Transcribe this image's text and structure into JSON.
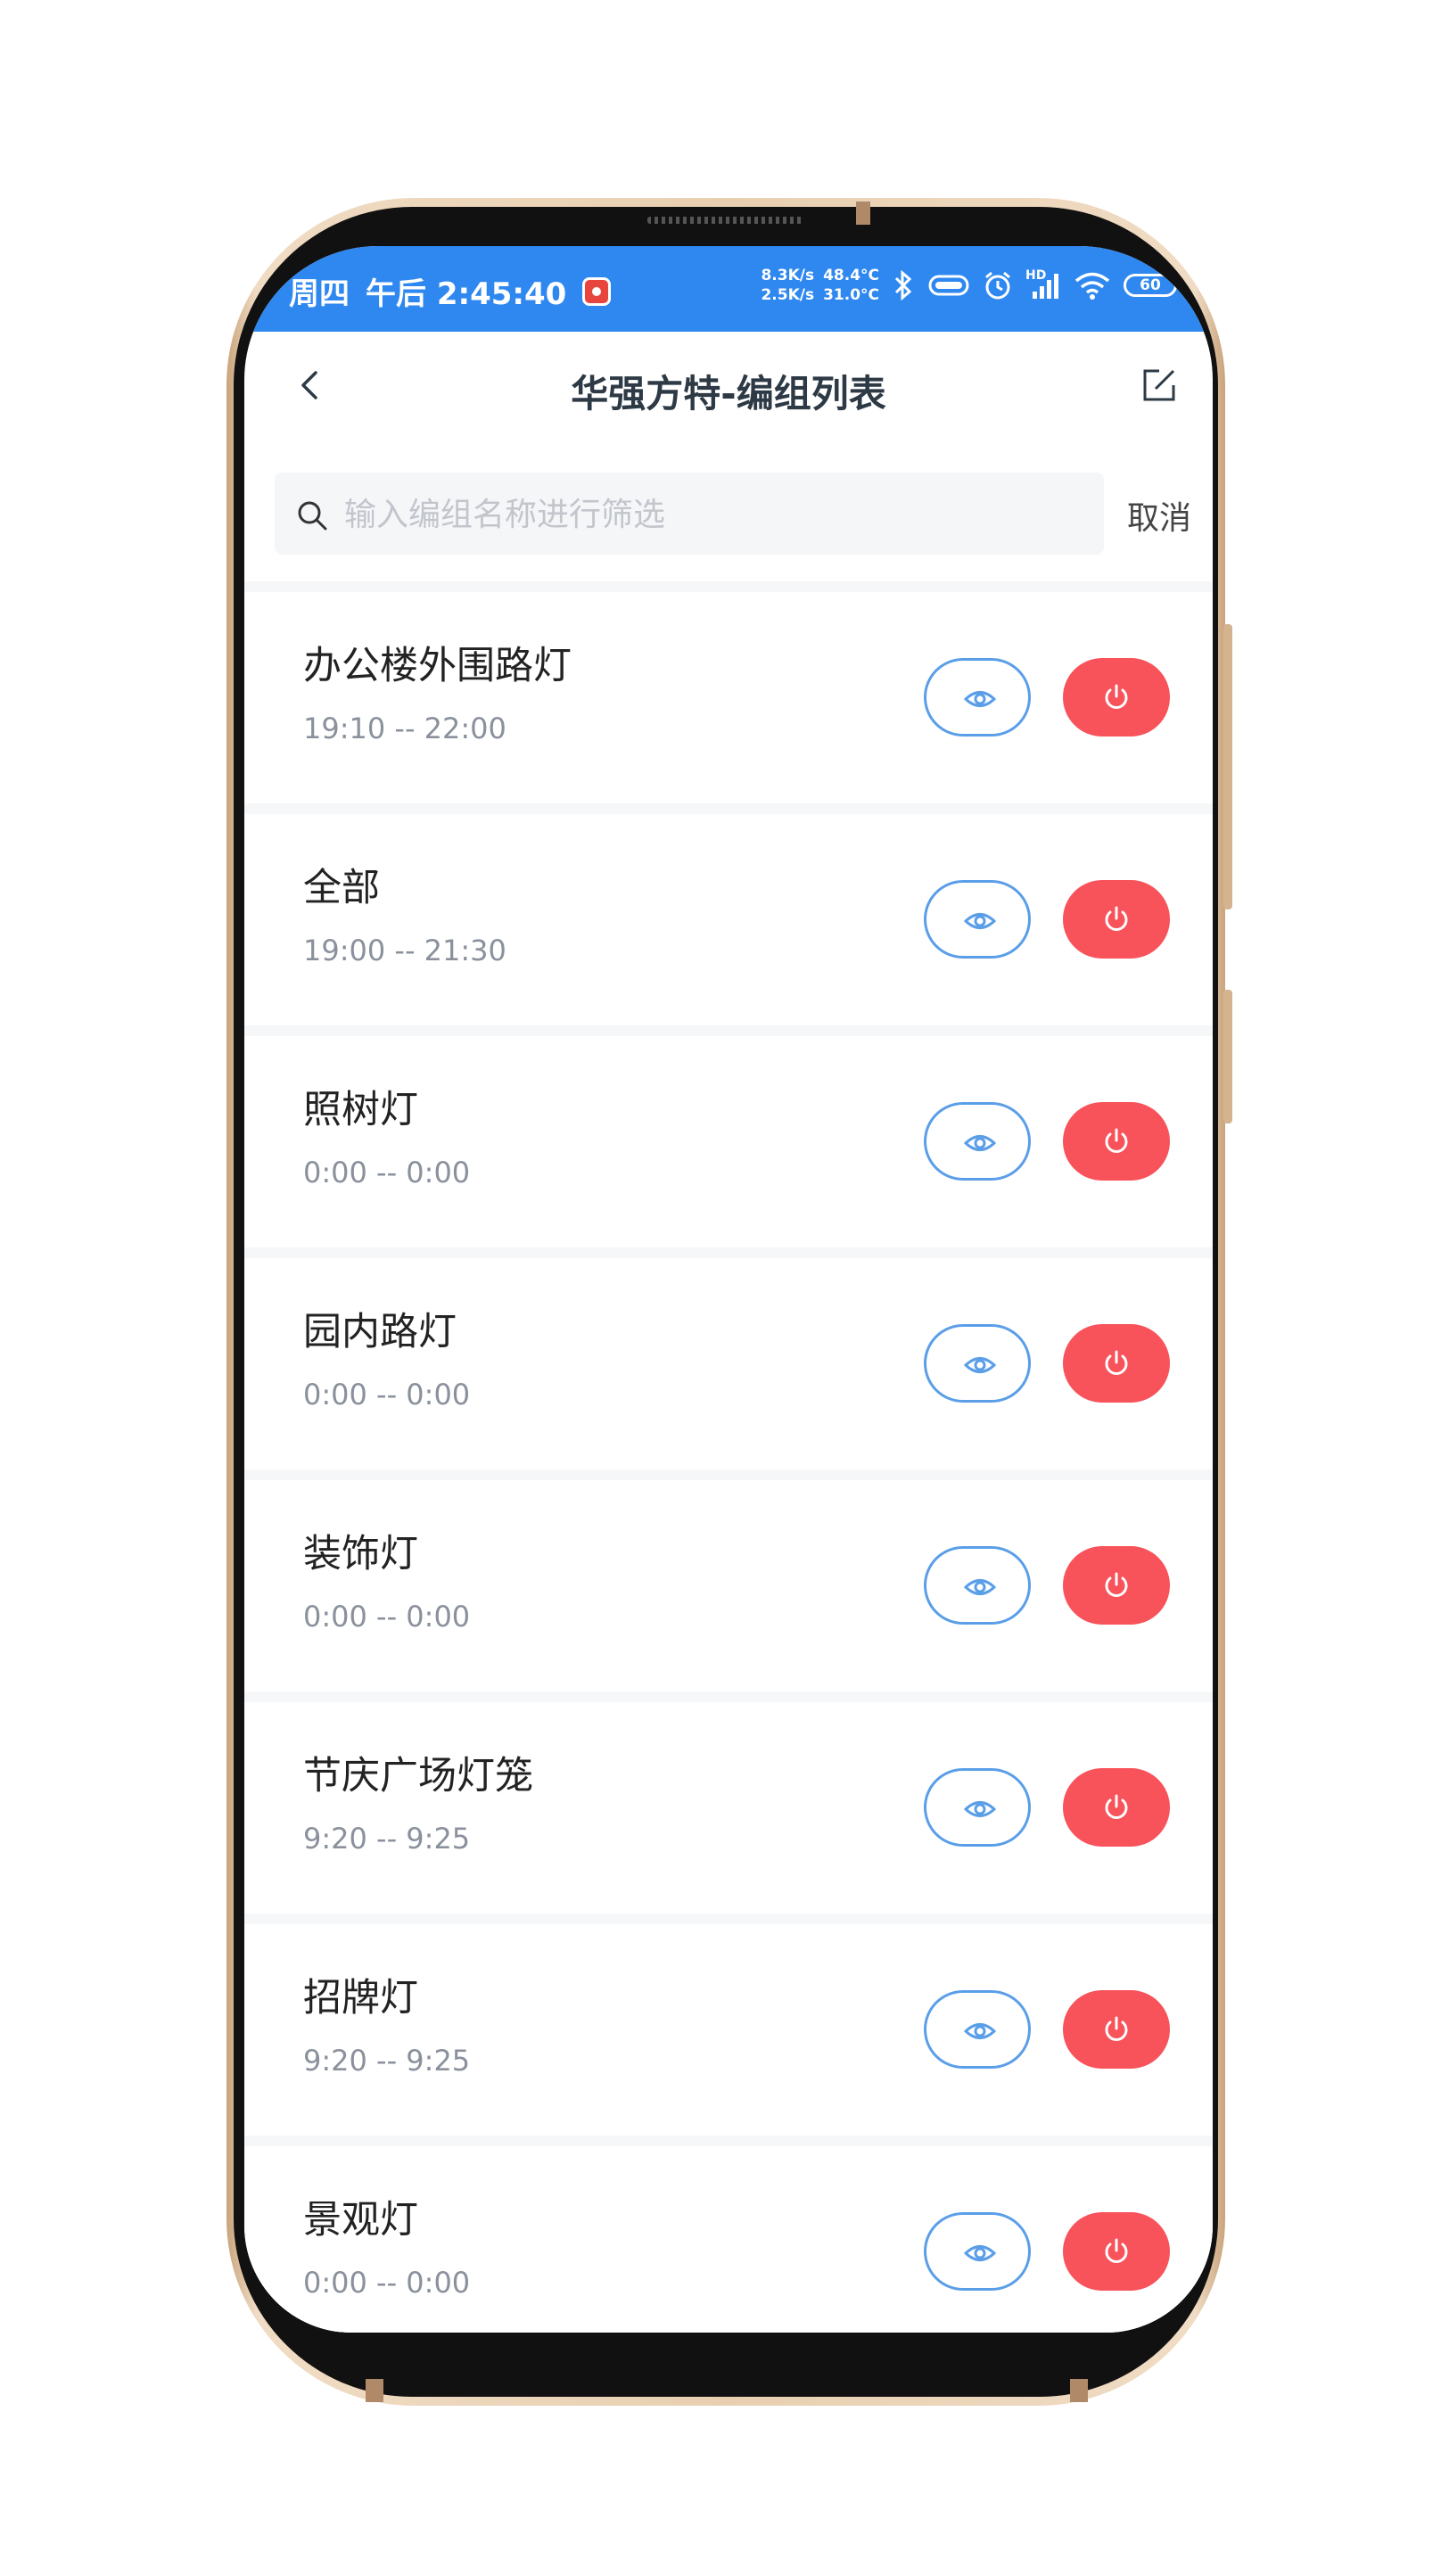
{
  "status_bar": {
    "day": "周四",
    "time": "午后 2:45:40",
    "net_up": "8.3K/s",
    "net_down": "2.5K/s",
    "temp_cpu": "48.4°C",
    "temp_battery": "31.0°C",
    "hd_label": "HD",
    "battery": "60"
  },
  "nav": {
    "title": "华强方特-编组列表",
    "back_icon": "chevron-left-icon",
    "edit_icon": "edit-icon"
  },
  "search": {
    "placeholder": "输入编组名称进行筛选",
    "value": "",
    "cancel_label": "取消"
  },
  "groups": [
    {
      "name": "办公楼外围路灯",
      "time": "19:10 -- 22:00"
    },
    {
      "name": "全部",
      "time": "19:00 -- 21:30"
    },
    {
      "name": "照树灯",
      "time": "0:00 -- 0:00"
    },
    {
      "name": "园内路灯",
      "time": "0:00 -- 0:00"
    },
    {
      "name": "装饰灯",
      "time": "0:00 -- 0:00"
    },
    {
      "name": "节庆广场灯笼",
      "time": "9:20 -- 9:25"
    },
    {
      "name": "招牌灯",
      "time": "9:20 -- 9:25"
    },
    {
      "name": "景观灯",
      "time": "0:00 -- 0:00"
    }
  ],
  "colors": {
    "status_bar": "#2f88f0",
    "view_button_border": "#5a9ee8",
    "power_button": "#f8525a",
    "title_text": "#2d3a45",
    "time_text": "#8a919c"
  }
}
